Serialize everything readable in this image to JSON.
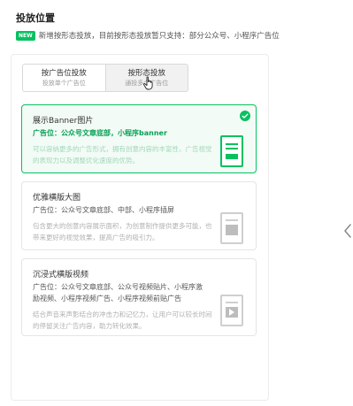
{
  "header": {
    "title": "投放位置",
    "badge": "NEW",
    "notice": "新增按形态投放，目前按形态投放暂只支持：部分公众号、小程序广告位"
  },
  "mode_tabs": [
    {
      "title": "按广告位投放",
      "subtitle": "投放单个广告位",
      "state": "default"
    },
    {
      "title": "按形态投放",
      "subtitle": "通投多个广告位",
      "state": "hover"
    }
  ],
  "options": [
    {
      "title": "展示Banner图片",
      "position": "广告位：公众号文章底部，小程序banner",
      "description": "可以容纳更多的广告形式，拥有创意内容的丰富性，广告视觉的表现力以及调整优化速度的优势。",
      "selected": true,
      "thumb_icon": "banner-layout-icon"
    },
    {
      "title": "优雅横版大图",
      "position": "广告位：公众号文章底部、中部、小程序插屏",
      "description": "包含更大的创意内容展示面积，为创意制作提供更多可能，也带来更好的视觉效果，提高广告的吸引力。",
      "selected": false,
      "thumb_icon": "large-image-layout-icon"
    },
    {
      "title": "沉浸式横版视频",
      "position": "广告位：公众号文章底部、公众号视频贴片、小程序激励视频、小程序视频广告、小程序视频前贴广告",
      "description": "结合声音来声影结合的冲击力和记忆力，让用户可以较长时间的停留关注广告内容，助力转化效果。",
      "selected": false,
      "thumb_icon": "video-layout-icon"
    }
  ],
  "colors": {
    "accent": "#07c160",
    "border": "#e5e5e5"
  }
}
